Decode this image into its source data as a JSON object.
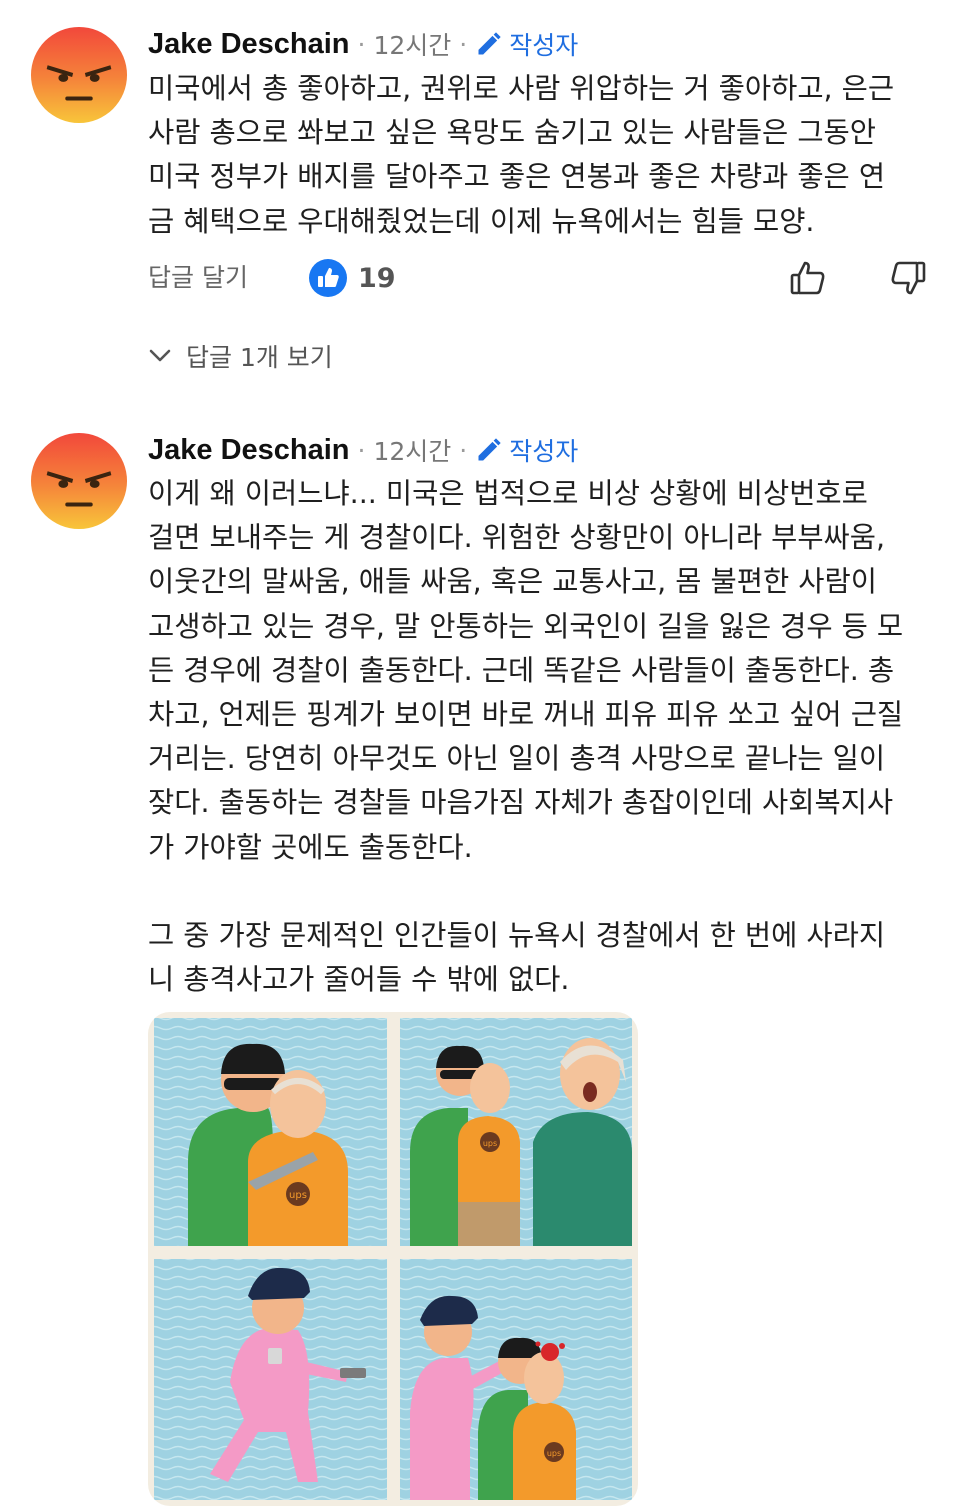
{
  "comments": [
    {
      "author": "Jake Deschain",
      "time": "12시간",
      "badge": "작성자",
      "lines": [
        "미국에서 총 좋아하고, 권위로 사람 위압하는 거 좋아하고, 은근",
        "사람 총으로 쏴보고 싶은 욕망도 숨기고 있는 사람들은 그동안",
        "미국 정부가 배지를 달아주고 좋은 연봉과 좋은 차량과 좋은 연",
        "금 혜택으로 우대해줬었는데 이제 뉴욕에서는 힘들 모양."
      ],
      "reply_label": "답글 달기",
      "like_count": "19",
      "view_replies_label": "답글 1개 보기"
    },
    {
      "author": "Jake Deschain",
      "time": "12시간",
      "badge": "작성자",
      "lines": [
        "이게 왜 이러느냐... 미국은 법적으로 비상 상황에 비상번호로",
        "걸면 보내주는 게 경찰이다. 위험한 상황만이 아니라 부부싸움,",
        "이웃간의 말싸움, 애들 싸움, 혹은 교통사고, 몸 불편한 사람이",
        "고생하고 있는 경우, 말 안통하는 외국인이 길을 잃은 경우 등 모",
        "든 경우에 경찰이 출동한다. 근데 똑같은 사람들이 출동한다. 총",
        "차고, 언제든 핑계가 보이면 바로 꺼내 피유 피유 쏘고 싶어 근질",
        "거리는. 당연히 아무것도 아닌 일이 총격 사망으로 끝나는 일이",
        "잦다. 출동하는 경찰들 마음가짐 자체가 총잡이인데 사회복지사",
        "가 가야할 곳에도 출동한다.",
        "",
        "그 중 가장 문제적인 인간들이 뉴욕시 경찰에서 한 번에 사라지",
        "니 총격사고가 줄어들 수 밖에 없다."
      ],
      "comic_labels": [
        "ups",
        "ups",
        "ups"
      ]
    }
  ],
  "colors": {
    "accent": "#1f6ee0",
    "like_badge": "#1877f2",
    "avatar_top": "#f2483b",
    "avatar_bottom": "#f8b53a"
  }
}
